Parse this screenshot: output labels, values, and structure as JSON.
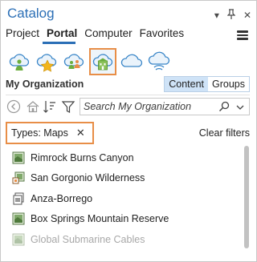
{
  "pane": {
    "title": "Catalog",
    "controls": {
      "dropdown": "▾",
      "pin": "⊥",
      "close": "✕"
    }
  },
  "tabs": [
    {
      "label": "Project",
      "active": false
    },
    {
      "label": "Portal",
      "active": true
    },
    {
      "label": "Computer",
      "active": false
    },
    {
      "label": "Favorites",
      "active": false
    }
  ],
  "sources": [
    {
      "name": "my-content-icon",
      "selected": false
    },
    {
      "name": "my-favorites-icon",
      "selected": false
    },
    {
      "name": "my-groups-icon",
      "selected": false
    },
    {
      "name": "my-organization-icon",
      "selected": true
    },
    {
      "name": "arcgis-online-icon",
      "selected": false
    },
    {
      "name": "living-atlas-icon",
      "selected": false
    }
  ],
  "org": {
    "title": "My Organization",
    "content_label": "Content",
    "groups_label": "Groups"
  },
  "search": {
    "placeholder": "Search My Organization"
  },
  "filter": {
    "chip_label": "Types: Maps",
    "clear_label": "Clear filters"
  },
  "items": [
    {
      "label": "Rimrock Burns Canyon",
      "icon": "map-icon"
    },
    {
      "label": "San Gorgonio Wilderness",
      "icon": "shared-map-icon"
    },
    {
      "label": "Anza-Borrego",
      "icon": "map-document-icon"
    },
    {
      "label": "Box Springs Mountain Reserve",
      "icon": "map-icon"
    },
    {
      "label": "Global Submarine Cables",
      "icon": "map-icon"
    }
  ],
  "colors": {
    "accent": "#2b6fb6",
    "highlight": "#e88e47",
    "selected_bg": "#cfe3f7"
  }
}
